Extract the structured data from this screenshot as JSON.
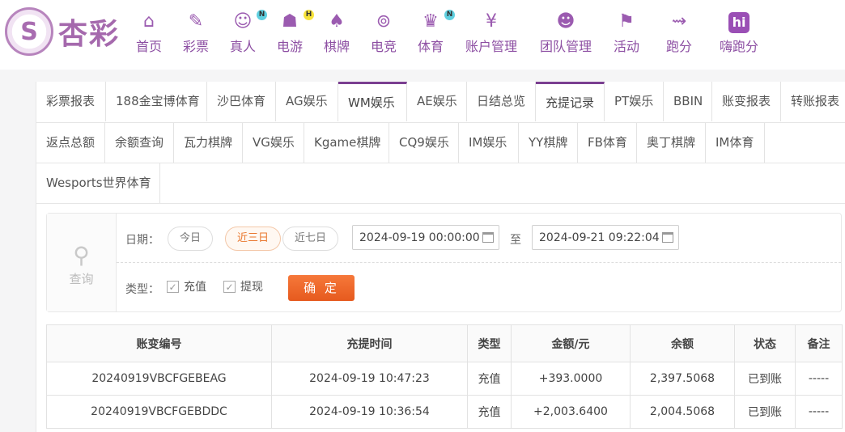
{
  "header": {
    "logo_text": "杏彩",
    "logo_mark": "S",
    "nav": [
      {
        "label": "首页",
        "icon": "home-icon",
        "glyph": "⌂",
        "badge": ""
      },
      {
        "label": "彩票",
        "icon": "lottery-ticket-icon",
        "glyph": "✎",
        "badge": ""
      },
      {
        "label": "真人",
        "icon": "live-dealer-icon",
        "glyph": "☺",
        "badge": "N"
      },
      {
        "label": "电游",
        "icon": "gamepad-icon",
        "glyph": "☗",
        "badge": "H"
      },
      {
        "label": "棋牌",
        "icon": "cards-icon",
        "glyph": "♠",
        "badge": ""
      },
      {
        "label": "电竞",
        "icon": "esports-controller-icon",
        "glyph": "⊚",
        "badge": ""
      },
      {
        "label": "体育",
        "icon": "trophy-icon",
        "glyph": "♛",
        "badge": "N"
      },
      {
        "label": "账户管理",
        "icon": "account-yen-icon",
        "glyph": "¥",
        "badge": ""
      },
      {
        "label": "团队管理",
        "icon": "team-users-icon",
        "glyph": "☻",
        "badge": ""
      },
      {
        "label": "活动",
        "icon": "gift-icon",
        "glyph": "⚑",
        "badge": ""
      },
      {
        "label": "跑分",
        "icon": "running-car-icon",
        "glyph": "⇝",
        "badge": ""
      },
      {
        "label": "嗨跑分",
        "icon": "hi-logo-icon",
        "glyph": "hi",
        "badge": ""
      }
    ]
  },
  "tabs": {
    "row1": [
      "彩票报表",
      "188金宝博体育",
      "沙巴体育",
      "AG娱乐",
      "WM娱乐",
      "AE娱乐",
      "日结总览",
      "充提记录",
      "PT娱乐",
      "BBIN",
      "账变报表",
      "转账报表"
    ],
    "row2": [
      "返点总额",
      "余额查询",
      "瓦力棋牌",
      "VG娱乐",
      "Kgame棋牌",
      "CQ9娱乐",
      "IM娱乐",
      "YY棋牌",
      "FB体育",
      "奥丁棋牌",
      "IM体育"
    ],
    "row3": [
      "Wesports世界体育"
    ],
    "active_primary": "充提记录"
  },
  "query": {
    "search_label": "查询",
    "date_label": "日期：",
    "quick_ranges": [
      "今日",
      "近三日",
      "近七日"
    ],
    "selected_range": "近三日",
    "start_date": "2024-09-19 00:00:00",
    "to_label": "至",
    "end_date": "2024-09-21 09:22:04",
    "type_label": "类型：",
    "types": [
      {
        "label": "充值",
        "checked": true
      },
      {
        "label": "提现",
        "checked": true
      }
    ],
    "confirm_label": "确 定"
  },
  "table": {
    "columns": [
      "账变编号",
      "充提时间",
      "类型",
      "金额/元",
      "余额",
      "状态",
      "备注"
    ],
    "rows": [
      {
        "id": "20240919VBCFGEBEAG",
        "time": "2024-09-19 10:47:23",
        "type": "充值",
        "amount": "+393.0000",
        "balance": "2,397.5068",
        "status": "已到账",
        "note": "-----"
      },
      {
        "id": "20240919VBCFGEBDDC",
        "time": "2024-09-19 10:36:54",
        "type": "充值",
        "amount": "+2,003.6400",
        "balance": "2,004.5068",
        "status": "已到账",
        "note": "-----"
      }
    ]
  },
  "colors": {
    "brand_purple": "#8d4fa3",
    "active_tab": "#7b3f91",
    "confirm_orange": "#f06a2c",
    "amount_red": "#e4242c",
    "status_green": "#3fa03f"
  }
}
